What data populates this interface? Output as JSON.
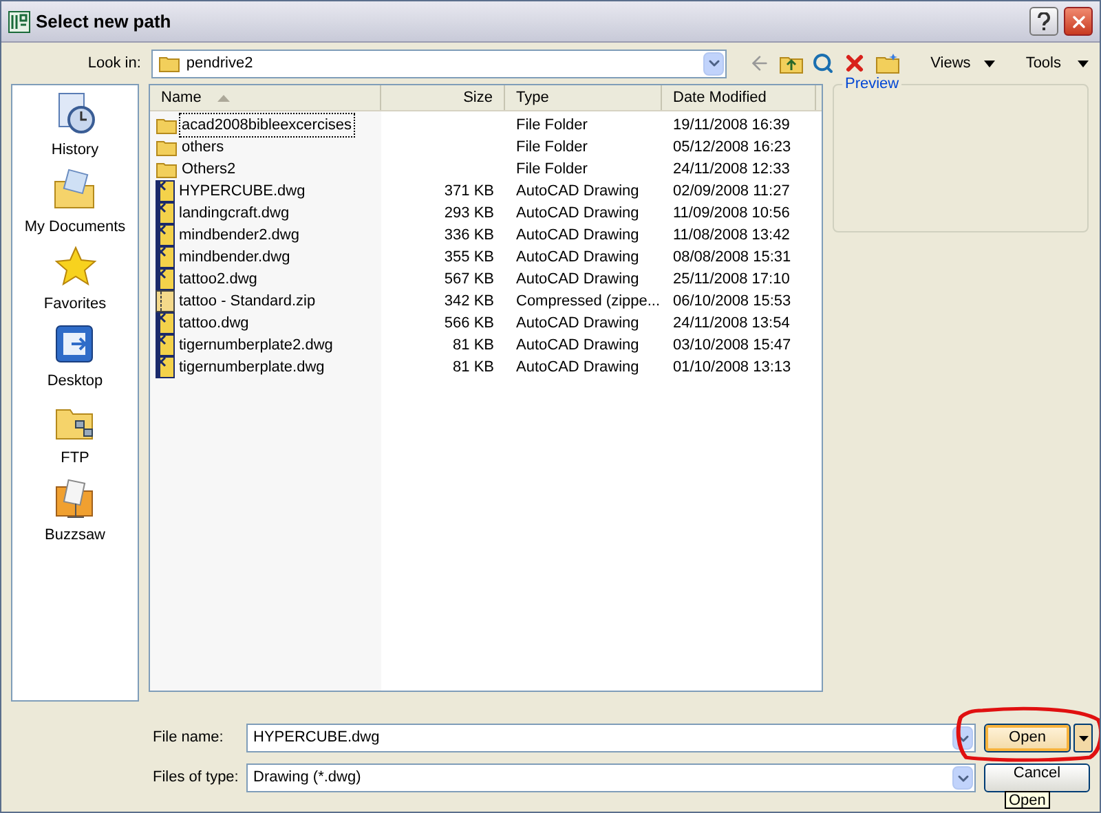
{
  "window": {
    "title": "Select new path"
  },
  "look_in": {
    "label": "Look in:",
    "value": "pendrive2"
  },
  "toolbar": {
    "views": "Views",
    "tools": "Tools"
  },
  "places": [
    {
      "label": "History",
      "kind": "history"
    },
    {
      "label": "My Documents",
      "kind": "documents"
    },
    {
      "label": "Favorites",
      "kind": "favorites"
    },
    {
      "label": "Desktop",
      "kind": "desktop"
    },
    {
      "label": "FTP",
      "kind": "ftp"
    },
    {
      "label": "Buzzsaw",
      "kind": "buzzsaw"
    }
  ],
  "file_list": {
    "columns": [
      {
        "label": "Name",
        "sorted": true
      },
      {
        "label": "Size",
        "sorted": false
      },
      {
        "label": "Type",
        "sorted": false
      },
      {
        "label": "Date Modified",
        "sorted": false
      }
    ],
    "rows": [
      {
        "kind": "folder",
        "name": "acad2008bibleexcercises",
        "size": "",
        "type": "File Folder",
        "date": "19/11/2008 16:39",
        "focused": true
      },
      {
        "kind": "folder",
        "name": "others",
        "size": "",
        "type": "File Folder",
        "date": "05/12/2008 16:23",
        "focused": false
      },
      {
        "kind": "folder",
        "name": "Others2",
        "size": "",
        "type": "File Folder",
        "date": "24/11/2008 12:33",
        "focused": false
      },
      {
        "kind": "dwg",
        "name": "HYPERCUBE.dwg",
        "size": "371 KB",
        "type": "AutoCAD Drawing",
        "date": "02/09/2008 11:27",
        "focused": false
      },
      {
        "kind": "dwg",
        "name": "landingcraft.dwg",
        "size": "293 KB",
        "type": "AutoCAD Drawing",
        "date": "11/09/2008 10:56",
        "focused": false
      },
      {
        "kind": "dwg",
        "name": "mindbender2.dwg",
        "size": "336 KB",
        "type": "AutoCAD Drawing",
        "date": "11/08/2008 13:42",
        "focused": false
      },
      {
        "kind": "dwg",
        "name": "mindbender.dwg",
        "size": "355 KB",
        "type": "AutoCAD Drawing",
        "date": "08/08/2008 15:31",
        "focused": false
      },
      {
        "kind": "dwg",
        "name": "tattoo2.dwg",
        "size": "567 KB",
        "type": "AutoCAD Drawing",
        "date": "25/11/2008 17:10",
        "focused": false
      },
      {
        "kind": "zip",
        "name": "tattoo - Standard.zip",
        "size": "342 KB",
        "type": "Compressed (zippe...",
        "date": "06/10/2008 15:53",
        "focused": false
      },
      {
        "kind": "dwg",
        "name": "tattoo.dwg",
        "size": "566 KB",
        "type": "AutoCAD Drawing",
        "date": "24/11/2008 13:54",
        "focused": false
      },
      {
        "kind": "dwg",
        "name": "tigernumberplate2.dwg",
        "size": "81 KB",
        "type": "AutoCAD Drawing",
        "date": "03/10/2008 15:47",
        "focused": false
      },
      {
        "kind": "dwg",
        "name": "tigernumberplate.dwg",
        "size": "81 KB",
        "type": "AutoCAD Drawing",
        "date": "01/10/2008 13:13",
        "focused": false
      }
    ]
  },
  "preview": {
    "label": "Preview"
  },
  "file_name": {
    "label": "File name:",
    "value": "HYPERCUBE.dwg"
  },
  "file_type": {
    "label": "Files of type:",
    "value": "Drawing (*.dwg)"
  },
  "buttons": {
    "open": "Open",
    "cancel": "Cancel"
  },
  "tooltip": "Open"
}
